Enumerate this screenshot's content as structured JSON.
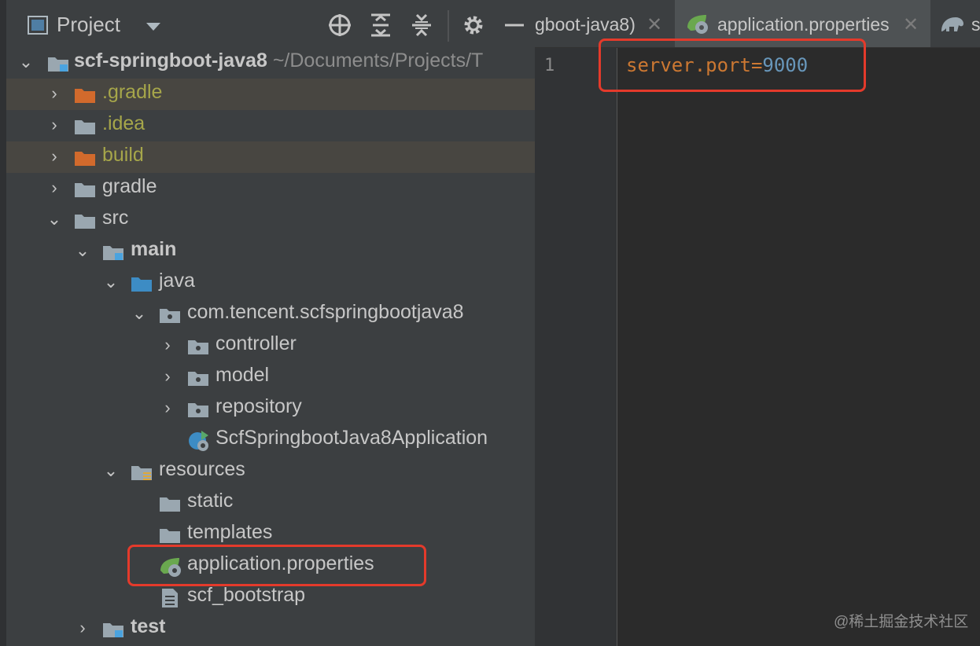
{
  "project_panel": {
    "title": "Project",
    "toolbar_icons": [
      "locate-icon",
      "expand-all-icon",
      "collapse-all-icon",
      "settings-icon",
      "hide-icon"
    ]
  },
  "tree": [
    {
      "label": "scf-springboot-java8",
      "path": "~/Documents/Projects/T",
      "expanded": true,
      "icon": "module-folder-icon",
      "bold": true
    },
    {
      "label": ".gradle",
      "expanded": false,
      "icon": "excluded-folder-icon",
      "ignored": true
    },
    {
      "label": ".idea",
      "expanded": false,
      "icon": "folder-icon",
      "dim": true
    },
    {
      "label": "build",
      "expanded": false,
      "icon": "excluded-folder-icon",
      "ignored": true
    },
    {
      "label": "gradle",
      "expanded": false,
      "icon": "folder-icon"
    },
    {
      "label": "src",
      "expanded": true,
      "icon": "folder-icon"
    },
    {
      "label": "main",
      "expanded": true,
      "icon": "source-set-folder-icon",
      "bold": true
    },
    {
      "label": "java",
      "expanded": true,
      "icon": "source-root-folder-icon"
    },
    {
      "label": "com.tencent.scfspringbootjava8",
      "expanded": true,
      "icon": "package-icon"
    },
    {
      "label": "controller",
      "expanded": false,
      "icon": "package-icon"
    },
    {
      "label": "model",
      "expanded": false,
      "icon": "package-icon"
    },
    {
      "label": "repository",
      "expanded": false,
      "icon": "package-icon"
    },
    {
      "label": "ScfSpringbootJava8Application",
      "icon": "spring-boot-class-icon"
    },
    {
      "label": "resources",
      "expanded": true,
      "icon": "resources-root-folder-icon"
    },
    {
      "label": "static",
      "icon": "folder-icon"
    },
    {
      "label": "templates",
      "icon": "folder-icon"
    },
    {
      "label": "application.properties",
      "icon": "spring-properties-icon",
      "highlighted": true
    },
    {
      "label": "scf_bootstrap",
      "icon": "text-file-icon"
    },
    {
      "label": "test",
      "expanded": false,
      "icon": "source-set-folder-icon",
      "bold": true
    }
  ],
  "tabs": [
    {
      "label": "gboot-java8)",
      "icon": "",
      "active": false
    },
    {
      "label": "application.properties",
      "icon": "spring-properties-icon",
      "active": true
    },
    {
      "label": "s",
      "icon": "gradle-icon",
      "active": false
    }
  ],
  "editor": {
    "line_number": "1",
    "code": {
      "key": "server.port",
      "eq": "=",
      "value": "9000"
    }
  },
  "colors": {
    "highlight_box": "#e43a2b",
    "key": "#cc7832",
    "value": "#6897bb",
    "ignored_row": "#484641"
  },
  "watermark": "@稀土掘金技术社区"
}
